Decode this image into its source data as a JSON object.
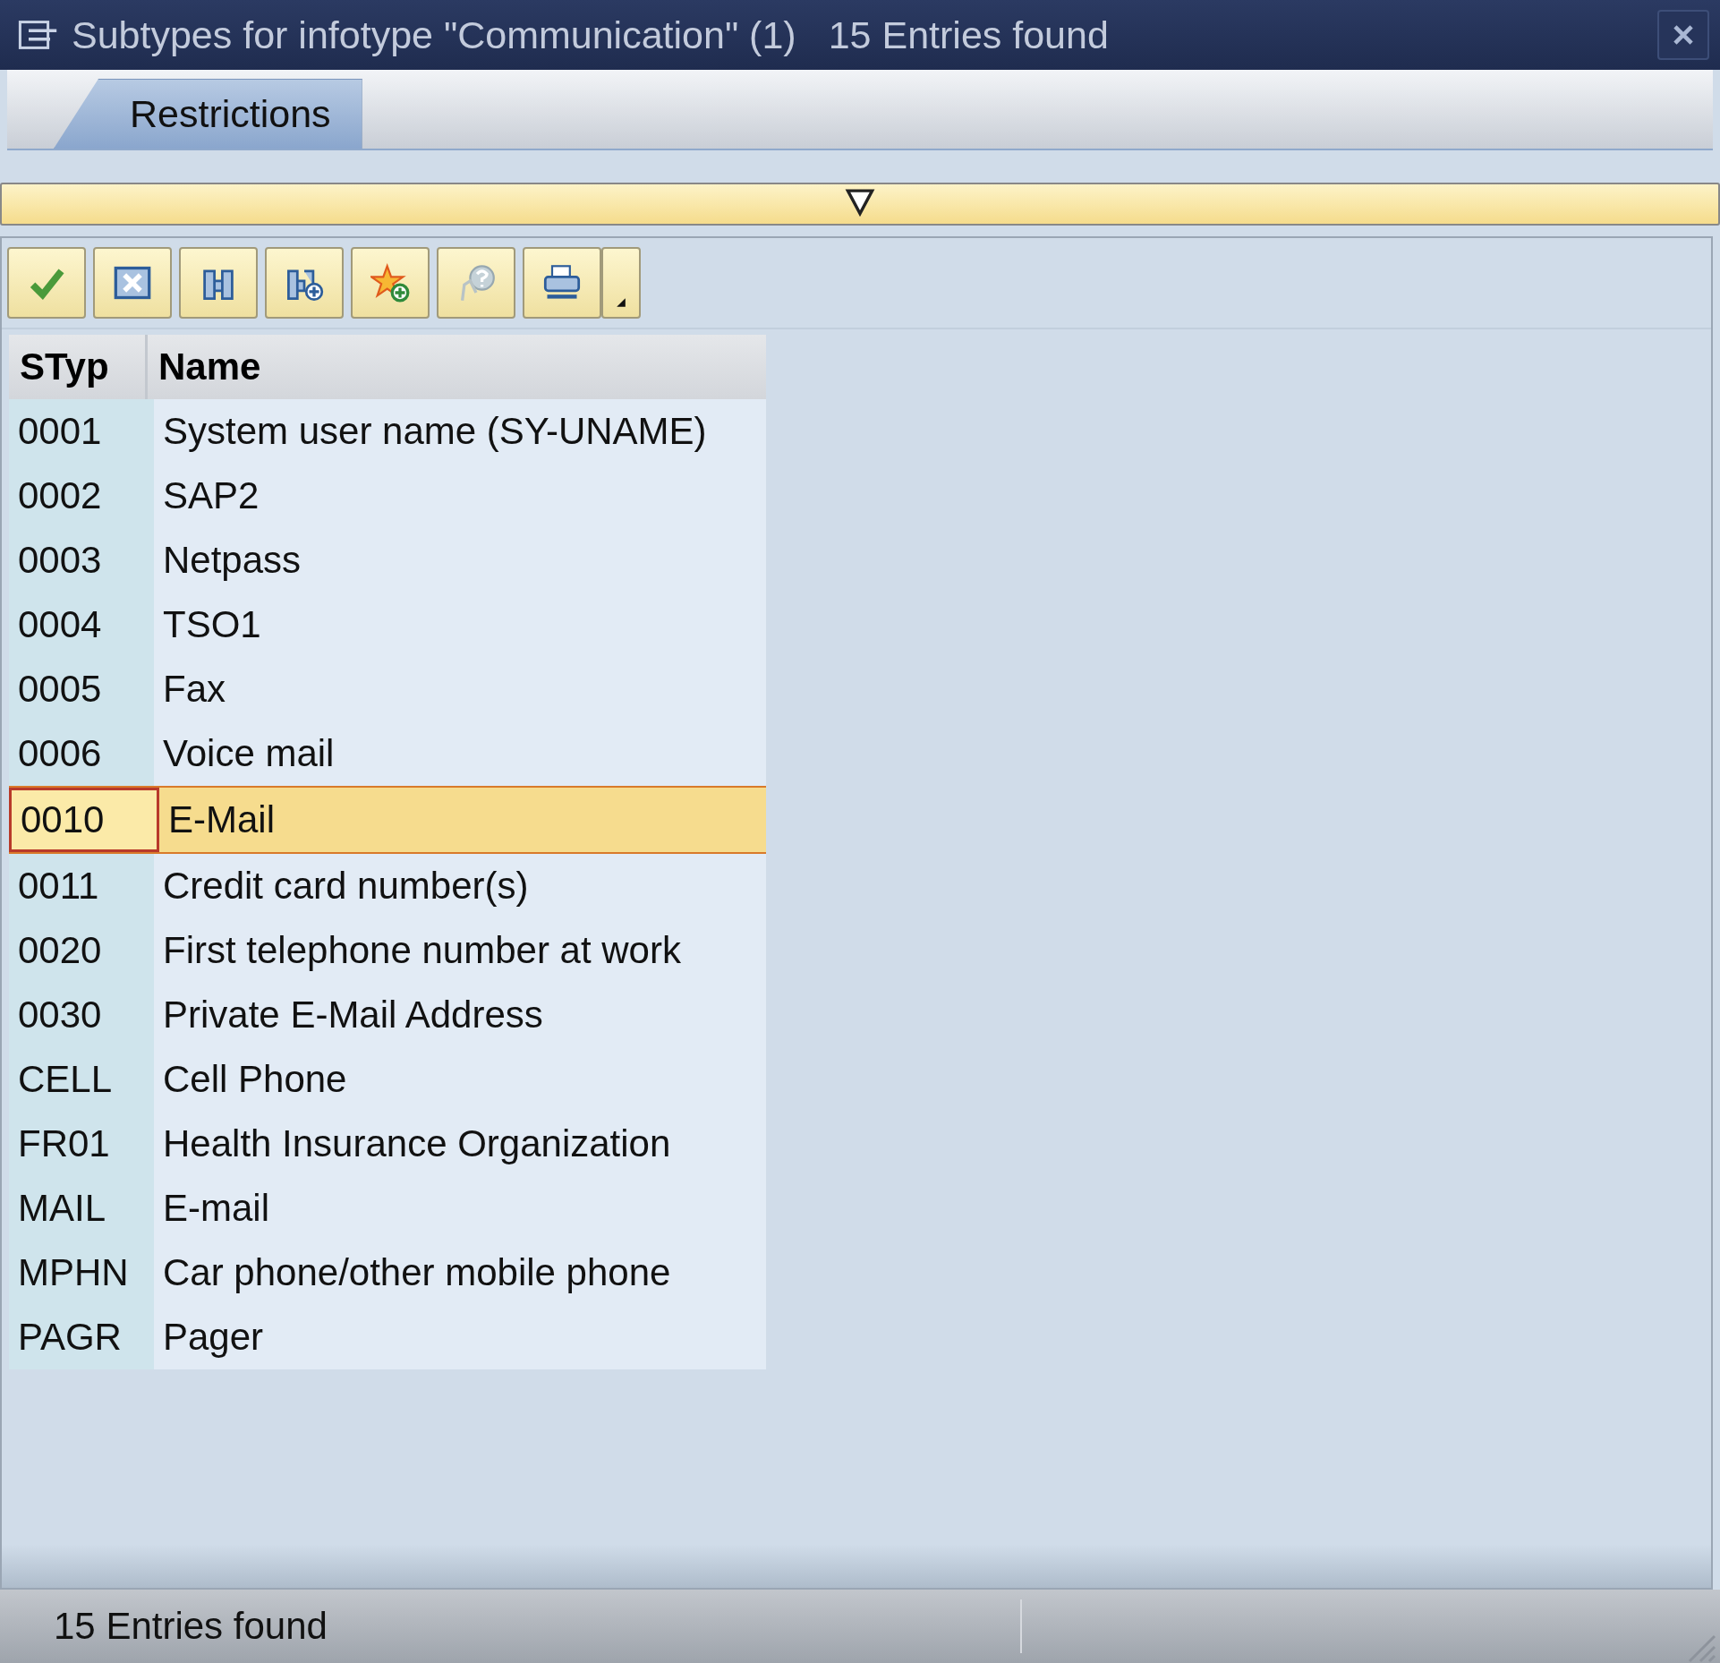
{
  "window": {
    "title": "Subtypes for infotype \"Communication\" (1)",
    "entries": "15 Entries found"
  },
  "tabs": [
    {
      "label": "Restrictions",
      "selected": true
    }
  ],
  "toolbar": [
    {
      "kind": "check"
    },
    {
      "kind": "cancel"
    },
    {
      "kind": "find"
    },
    {
      "kind": "find-next"
    },
    {
      "kind": "favorite-add"
    },
    {
      "kind": "help"
    },
    {
      "kind": "print"
    },
    {
      "kind": "dropdown"
    }
  ],
  "table": {
    "columns": [
      "STyp",
      "Name"
    ],
    "rows": [
      {
        "styp": "0001",
        "name": "System user name (SY-UNAME)",
        "selected": false
      },
      {
        "styp": "0002",
        "name": "SAP2",
        "selected": false
      },
      {
        "styp": "0003",
        "name": "Netpass",
        "selected": false
      },
      {
        "styp": "0004",
        "name": "TSO1",
        "selected": false
      },
      {
        "styp": "0005",
        "name": "Fax",
        "selected": false
      },
      {
        "styp": "0006",
        "name": "Voice mail",
        "selected": false
      },
      {
        "styp": "0010",
        "name": "E-Mail",
        "selected": true
      },
      {
        "styp": "0011",
        "name": "Credit card number(s)",
        "selected": false
      },
      {
        "styp": "0020",
        "name": "First telephone number at work",
        "selected": false
      },
      {
        "styp": "0030",
        "name": "Private E-Mail Address",
        "selected": false
      },
      {
        "styp": "CELL",
        "name": "Cell Phone",
        "selected": false
      },
      {
        "styp": "FR01",
        "name": "Health Insurance Organization",
        "selected": false
      },
      {
        "styp": "MAIL",
        "name": "E-mail",
        "selected": false
      },
      {
        "styp": "MPHN",
        "name": "Car phone/other mobile phone",
        "selected": false
      },
      {
        "styp": "PAGR",
        "name": "Pager",
        "selected": false
      }
    ]
  },
  "status_bar": {
    "text": "15 Entries found"
  }
}
